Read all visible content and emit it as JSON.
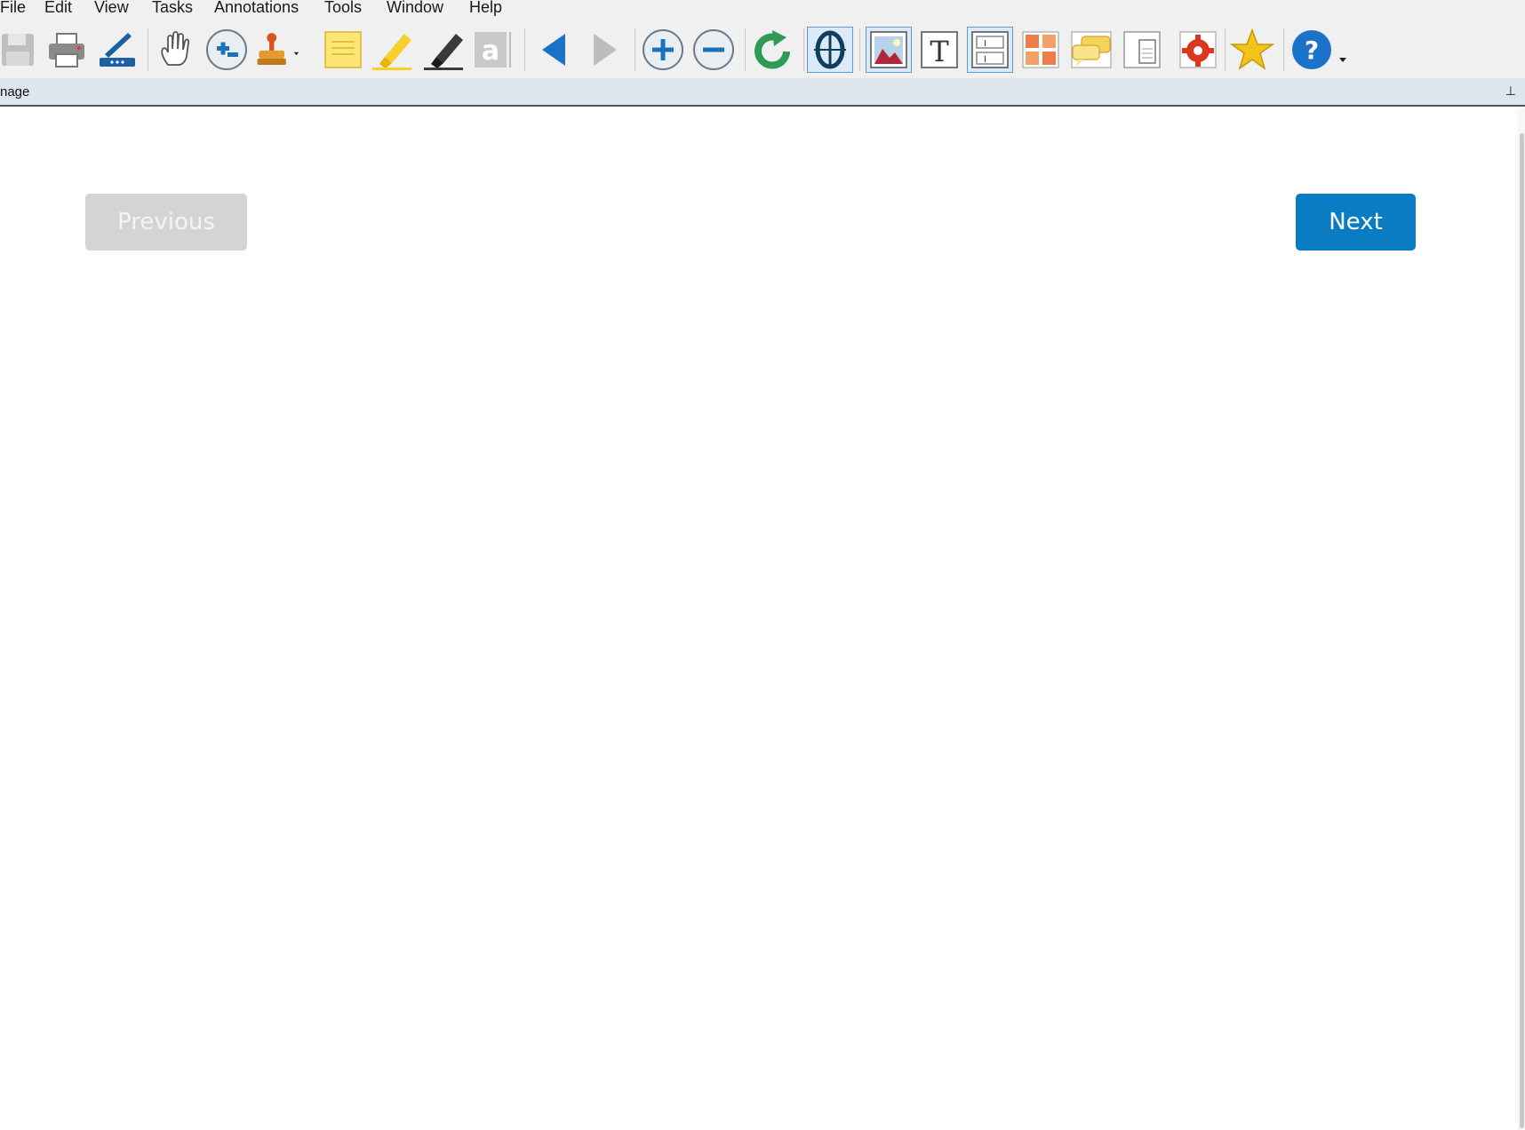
{
  "menubar": {
    "items": [
      {
        "label": "File"
      },
      {
        "label": "Edit"
      },
      {
        "label": "View"
      },
      {
        "label": "Tasks"
      },
      {
        "label": "Annotations"
      },
      {
        "label": "Tools"
      },
      {
        "label": "Window"
      },
      {
        "label": "Help"
      }
    ]
  },
  "panel": {
    "title": "nage"
  },
  "navigation": {
    "previous_label": "Previous",
    "next_label": "Next"
  },
  "colors": {
    "accent": "#0a7cc4",
    "disabled": "#d4d4d4"
  }
}
